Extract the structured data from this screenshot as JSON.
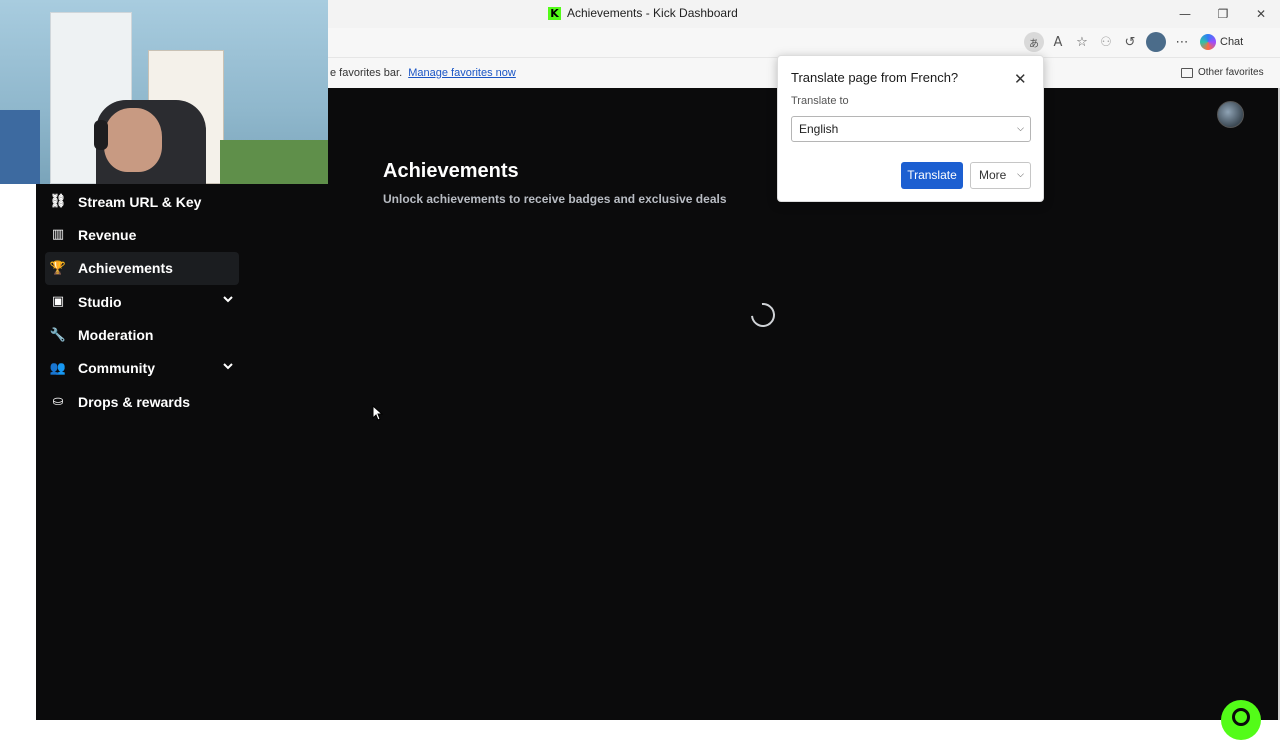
{
  "window": {
    "tab_title": "Achievements - Kick Dashboard",
    "favicon_letter": "K",
    "minimize": "—",
    "restore": "❐",
    "close": "✕"
  },
  "toolbar": {
    "chat_label": "Chat"
  },
  "favorites_bar": {
    "message": "e favorites bar.",
    "link": "Manage favorites now",
    "other_favorites": "Other favorites"
  },
  "sidebar": {
    "items": [
      {
        "label": "Stream URL & Key",
        "icon": "link-icon",
        "glyph": "⛓",
        "active": false,
        "expandable": false
      },
      {
        "label": "Revenue",
        "icon": "bar-chart-icon",
        "glyph": "▥",
        "active": false,
        "expandable": false
      },
      {
        "label": "Achievements",
        "icon": "trophy-icon",
        "glyph": "🏆",
        "active": true,
        "expandable": false
      },
      {
        "label": "Studio",
        "icon": "studio-icon",
        "glyph": "▣",
        "active": false,
        "expandable": true
      },
      {
        "label": "Moderation",
        "icon": "wrench-icon",
        "glyph": "🔧",
        "active": false,
        "expandable": false
      },
      {
        "label": "Community",
        "icon": "people-icon",
        "glyph": "👥",
        "active": false,
        "expandable": true
      },
      {
        "label": "Drops & rewards",
        "icon": "drops-icon",
        "glyph": "⛀",
        "active": false,
        "expandable": false
      }
    ]
  },
  "main": {
    "title": "Achievements",
    "subtitle": "Unlock achievements to receive badges and exclusive deals",
    "loading": true
  },
  "translate_popup": {
    "title": "Translate page from French?",
    "label": "Translate to",
    "selected_language": "English",
    "translate_button": "Translate",
    "more_button": "More"
  },
  "colors": {
    "brand_green": "#53fc18",
    "page_background": "#0b0b0c",
    "translate_blue": "#1c5fd1"
  }
}
